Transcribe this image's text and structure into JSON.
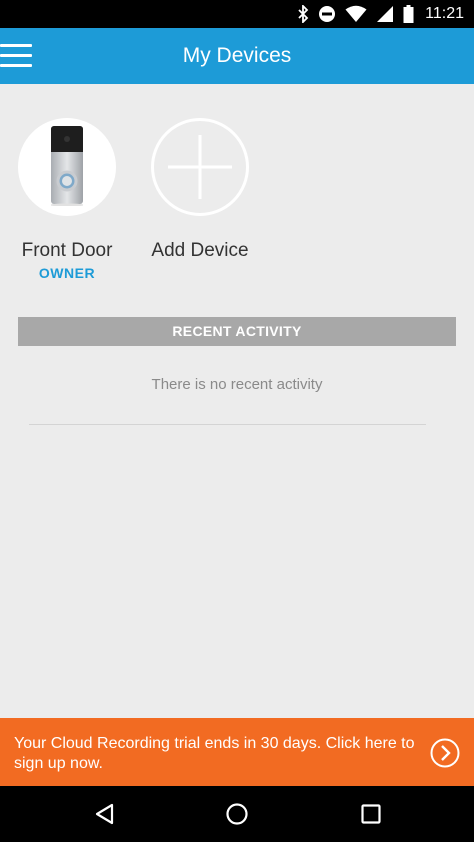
{
  "status_bar": {
    "time": "11:21",
    "icons": [
      "bluetooth-icon",
      "do-not-disturb-icon",
      "wifi-icon",
      "cell-signal-icon",
      "battery-icon"
    ]
  },
  "app_bar": {
    "title": "My Devices",
    "menu_icon": "hamburger-menu-icon"
  },
  "devices": [
    {
      "name": "Front Door",
      "role": "OWNER",
      "icon": "doorbell-image"
    },
    {
      "name": "Add Device",
      "role": "",
      "icon": "plus-icon"
    }
  ],
  "recent_activity": {
    "header": "RECENT ACTIVITY",
    "empty_message": "There is no recent activity"
  },
  "promo": {
    "text": "Your Cloud Recording trial ends in 30 days. Click here to sign up now.",
    "icon": "chevron-right-circle-icon"
  },
  "nav_bar": {
    "icons": [
      "back-icon",
      "home-icon",
      "recents-icon"
    ]
  },
  "colors": {
    "brand_blue": "#1d9bd7",
    "promo_orange": "#f26b22",
    "background": "#ececec",
    "section_gray": "#a8a8a8"
  }
}
